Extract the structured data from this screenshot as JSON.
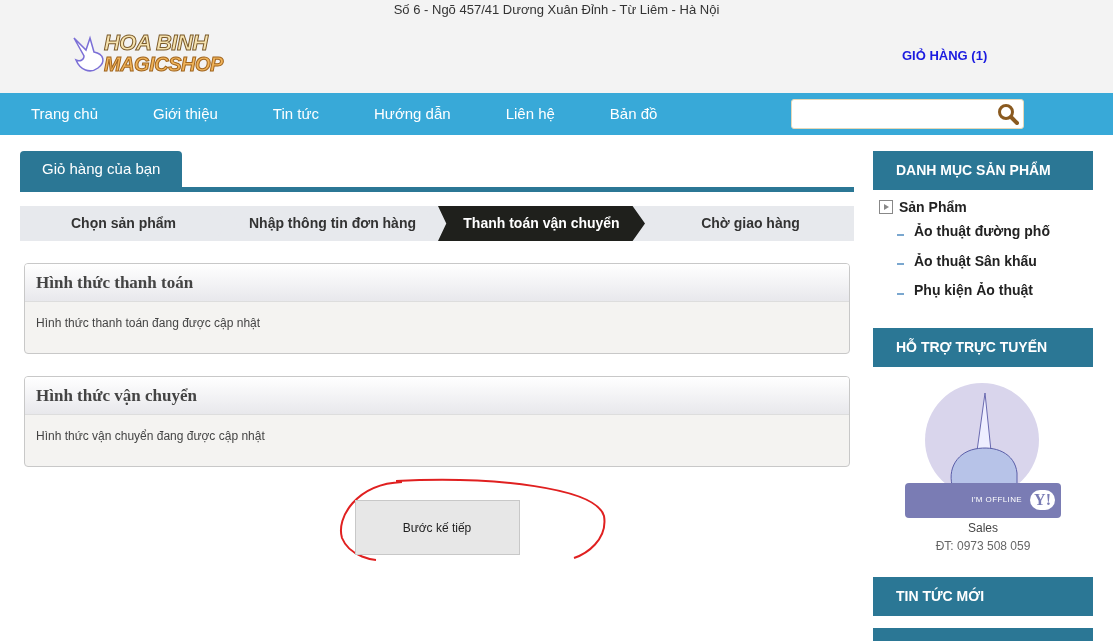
{
  "header": {
    "address": "Số 6 - Ngõ 457/41 Dương Xuân Đỉnh - Từ Liêm - Hà Nội",
    "logo": {
      "line1": "HOA BINH",
      "line2": "MAGICSHOP"
    },
    "cart_link": "GIỎ HÀNG (1)"
  },
  "nav": {
    "items": [
      "Trang chủ",
      "Giới thiệu",
      "Tin tức",
      "Hướng dẫn",
      "Liên hệ",
      "Bản đồ"
    ]
  },
  "main": {
    "tab": "Giỏ hàng của bạn",
    "steps": [
      {
        "label": "Chọn sản phẩm",
        "selected": false
      },
      {
        "label": "Nhập thông tin đơn hàng",
        "selected": false
      },
      {
        "label": "Thanh toán vận chuyển",
        "selected": true
      },
      {
        "label": "Chờ giao hàng",
        "selected": false
      }
    ],
    "panels": [
      {
        "title": "Hình thức thanh toán",
        "body": "Hình thức thanh toán đang được cập nhật"
      },
      {
        "title": "Hình thức vận chuyển",
        "body": "Hình thức vận chuyển đang được cập nhật"
      }
    ],
    "next_button": "Bước kế tiếp"
  },
  "sidebar": {
    "categories": {
      "title": "DANH MỤC SẢN PHẨM",
      "items": [
        {
          "label": "Sản Phẩm",
          "children": [
            {
              "label": "Ảo thuật đường phố"
            },
            {
              "label": "Ảo thuật Sân khấu"
            },
            {
              "label": "Phụ kiện Ảo thuật"
            }
          ]
        }
      ]
    },
    "support": {
      "title": "HỖ TRỢ TRỰC TUYẾN",
      "badge": {
        "status": "I'M OFFLINE",
        "logo": "Y!"
      },
      "name": "Sales",
      "phone": "ĐT: 0973 508 059"
    },
    "news": {
      "title": "TIN TỨC MỚI"
    }
  }
}
